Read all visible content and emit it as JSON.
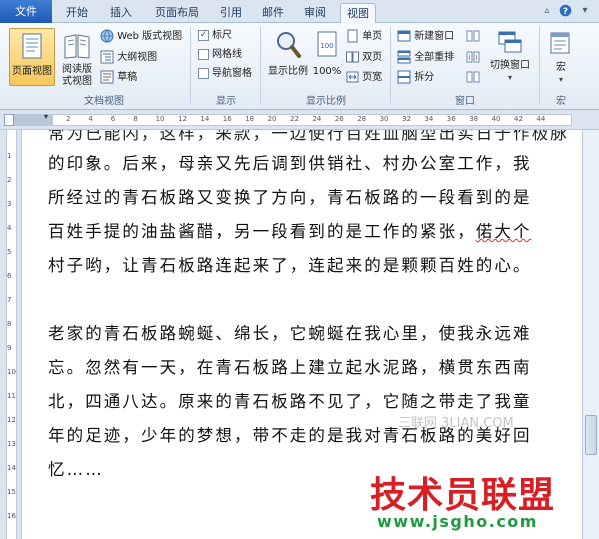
{
  "tabs": {
    "file": "文件",
    "home": "开始",
    "insert": "插入",
    "layout": "页面布局",
    "references": "引用",
    "mailings": "邮件",
    "review": "审阅",
    "view": "视图"
  },
  "ribbon": {
    "doc_views": {
      "print_layout": "页面视图",
      "full_reading": "阅读版式视图",
      "web_layout": "Web 版式视图",
      "outline": "大纲视图",
      "draft": "草稿",
      "group_label": "文档视图"
    },
    "show": {
      "ruler": "标尺",
      "gridlines": "网格线",
      "nav_pane": "导航窗格",
      "group_label": "显示"
    },
    "zoom": {
      "zoom": "显示比例",
      "hundred": "100%",
      "one_page": "单页",
      "two_pages": "双页",
      "page_width": "页宽",
      "group_label": "显示比例"
    },
    "window": {
      "new_window": "新建窗口",
      "arrange_all": "全部重排",
      "split": "拆分",
      "switch_windows": "切换窗口",
      "group_label": "窗口"
    },
    "macros": {
      "macros": "宏",
      "group_label": "宏"
    }
  },
  "ruler": {
    "ticks": [
      "2",
      "4",
      "6",
      "8",
      "10",
      "12",
      "14",
      "16",
      "18",
      "20",
      "22",
      "24",
      "26",
      "28",
      "30",
      "32",
      "34",
      "36",
      "38",
      "40",
      "42",
      "44"
    ],
    "vticks": [
      "1",
      "2",
      "3",
      "4",
      "5",
      "6",
      "7",
      "8",
      "9",
      "10",
      "11",
      "12",
      "13",
      "14",
      "15",
      "16"
    ]
  },
  "document": {
    "cut_line": "常为已能闪，这样，采款，一边使行百姓血脑型出实日于作极脉",
    "p1": [
      "的印象。后来，母亲又先后调到供销社、村办公室工作，我",
      "所经过的青石板路又变换了方向，青石板路的一段看到的是",
      "百姓手提的油盐酱醋，另一段看到的是工作的紧张，",
      "村子哟，让青石板路连起来了，连起来的是颗颗百姓的心。"
    ],
    "p1_squig": "偌大个",
    "p2": [
      "老家的青石板路蜿蜒、绵长，它蜿蜒在我心里，使我永远难",
      "忘。忽然有一天，在青石板路上建立起水泥路，横贯东西南",
      "北，四通八达。原来的青石板路不见了，它随之带走了我童",
      "年的足迹，少年的梦想，带不走的是我对青石板路的美好回",
      "忆……"
    ]
  },
  "watermarks": {
    "site1": "三联网 3LIAN.COM",
    "brand": "技术员联盟",
    "url": "www.jsgho.com"
  }
}
